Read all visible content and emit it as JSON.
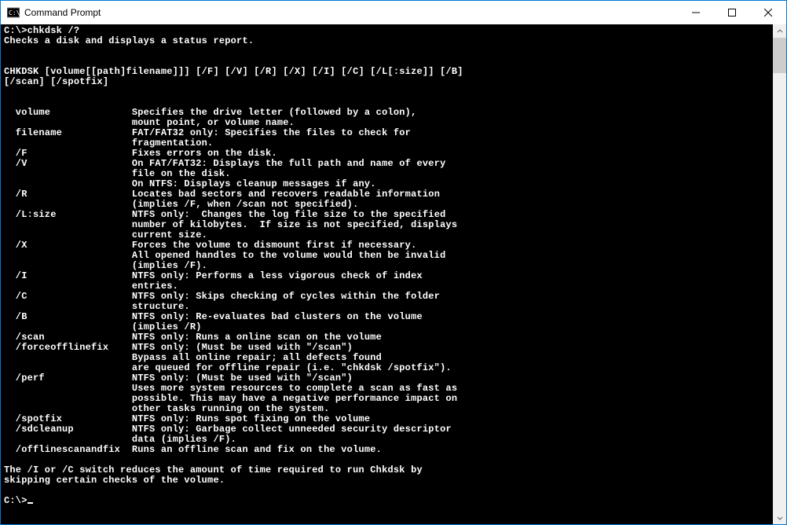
{
  "window": {
    "title": "Command Prompt"
  },
  "console": {
    "prompt1": "C:\\>",
    "command": "chkdsk /?",
    "desc": "Checks a disk and displays a status report.",
    "blank": "",
    "syntax1": "CHKDSK [volume[[path]filename]]] [/F] [/V] [/R] [/X] [/I] [/C] [/L[:size]] [/B]",
    "syntax2": "[/scan] [/spotfix]",
    "p_volume_k": "  volume              ",
    "p_volume_v1": "Specifies the drive letter (followed by a colon),",
    "p_volume_v2": "                      mount point, or volume name.",
    "p_filename_k": "  filename            ",
    "p_filename_v1": "FAT/FAT32 only: Specifies the files to check for",
    "p_filename_v2": "                      fragmentation.",
    "p_f_k": "  /F                  ",
    "p_f_v": "Fixes errors on the disk.",
    "p_v_k": "  /V                  ",
    "p_v_v1": "On FAT/FAT32: Displays the full path and name of every",
    "p_v_v2": "                      file on the disk.",
    "p_v_v3": "                      On NTFS: Displays cleanup messages if any.",
    "p_r_k": "  /R                  ",
    "p_r_v1": "Locates bad sectors and recovers readable information",
    "p_r_v2": "                      (implies /F, when /scan not specified).",
    "p_l_k": "  /L:size             ",
    "p_l_v1": "NTFS only:  Changes the log file size to the specified",
    "p_l_v2": "                      number of kilobytes.  If size is not specified, displays",
    "p_l_v3": "                      current size.",
    "p_x_k": "  /X                  ",
    "p_x_v1": "Forces the volume to dismount first if necessary.",
    "p_x_v2": "                      All opened handles to the volume would then be invalid",
    "p_x_v3": "                      (implies /F).",
    "p_i_k": "  /I                  ",
    "p_i_v1": "NTFS only: Performs a less vigorous check of index",
    "p_i_v2": "                      entries.",
    "p_c_k": "  /C                  ",
    "p_c_v1": "NTFS only: Skips checking of cycles within the folder",
    "p_c_v2": "                      structure.",
    "p_b_k": "  /B                  ",
    "p_b_v1": "NTFS only: Re-evaluates bad clusters on the volume",
    "p_b_v2": "                      (implies /R)",
    "p_scan_k": "  /scan               ",
    "p_scan_v": "NTFS only: Runs a online scan on the volume",
    "p_force_k": "  /forceofflinefix    ",
    "p_force_v1": "NTFS only: (Must be used with \"/scan\")",
    "p_force_v2": "                      Bypass all online repair; all defects found",
    "p_force_v3": "                      are queued for offline repair (i.e. \"chkdsk /spotfix\").",
    "p_perf_k": "  /perf               ",
    "p_perf_v1": "NTFS only: (Must be used with \"/scan\")",
    "p_perf_v2": "                      Uses more system resources to complete a scan as fast as",
    "p_perf_v3": "                      possible. This may have a negative performance impact on",
    "p_perf_v4": "                      other tasks running on the system.",
    "p_spot_k": "  /spotfix            ",
    "p_spot_v": "NTFS only: Runs spot fixing on the volume",
    "p_sdc_k": "  /sdcleanup          ",
    "p_sdc_v1": "NTFS only: Garbage collect unneeded security descriptor",
    "p_sdc_v2": "                      data (implies /F).",
    "p_off_k": "  /offlinescanandfix  ",
    "p_off_v": "Runs an offline scan and fix on the volume.",
    "footer1": "The /I or /C switch reduces the amount of time required to run Chkdsk by",
    "footer2": "skipping certain checks of the volume.",
    "prompt2": "C:\\>"
  }
}
